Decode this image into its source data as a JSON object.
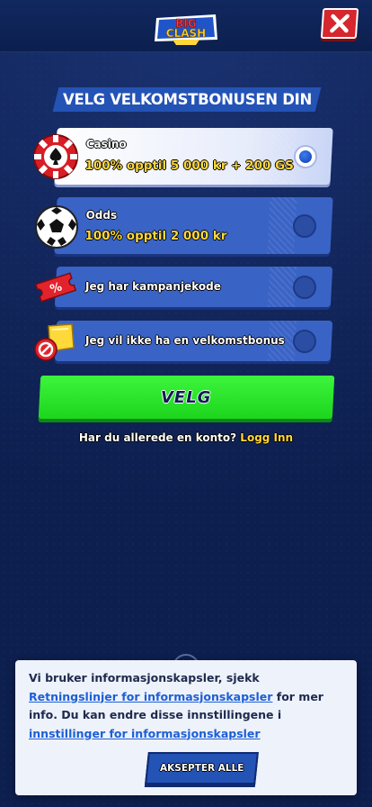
{
  "header": {
    "logo_top": "BIG",
    "logo_bottom": "CLASH"
  },
  "title": "VELG VELKOMSTBONUSEN DIN",
  "options": [
    {
      "label": "Casino",
      "detail": "100% opptil 5 000 kr + 200 GS",
      "selected": true,
      "icon": "poker-chip-icon"
    },
    {
      "label": "Odds",
      "detail": "100% opptil 2 000 kr",
      "selected": false,
      "icon": "soccer-ball-icon"
    },
    {
      "label": "Jeg har kampanjekode",
      "selected": false,
      "icon": "promo-ticket-icon"
    },
    {
      "label": "Jeg vil ikke ha en velkomstbonus",
      "selected": false,
      "icon": "no-bonus-icon"
    }
  ],
  "velg_button": "VELG",
  "login": {
    "prompt": "Har du allerede en konto?",
    "link": "Logg Inn"
  },
  "cookie": {
    "text_1": "Vi bruker informasjonskapsler, sjekk",
    "link_1": "Retningslinjer for informasjonskapsler",
    "text_2": "for mer info. Du kan endre disse innstillingene i",
    "link_2": "innstillinger for informasjonskapsler",
    "accept_button": "AKSEPTER ALLE"
  },
  "colors": {
    "background": "#0d1f4f",
    "option_blue": "#3a63c6",
    "accent_yellow": "#ffd83a",
    "green_button": "#1ed51e",
    "close_red": "#d6262e"
  }
}
